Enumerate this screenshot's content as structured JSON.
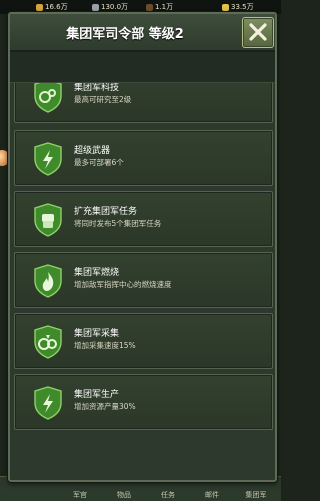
{
  "resources": [
    {
      "icon": "food-icon",
      "value": "16.6万",
      "color": "#d8a43a"
    },
    {
      "icon": "ore-icon",
      "value": "130.0万",
      "color": "#9aa0a8"
    },
    {
      "icon": "oil-icon",
      "value": "1.1万",
      "color": "#6b4b2a"
    },
    {
      "icon": "cash-icon",
      "value": "33.5万",
      "color": "#e3c24a"
    }
  ],
  "modal": {
    "title": "集团军司令部 等级2",
    "close_icon": "close-x-icon"
  },
  "items": [
    {
      "title": "集团军科技",
      "desc": "最高可研究至2级",
      "icon": "research-icon"
    },
    {
      "title": "超级武器",
      "desc": "最多可部署6个",
      "icon": "lightning-icon"
    },
    {
      "title": "扩充集团军任务",
      "desc": "将同时发布5个集团军任务",
      "icon": "fist-icon"
    },
    {
      "title": "集团军燃烧",
      "desc": "增加敌军指挥中心的燃烧速度",
      "icon": "fire-icon"
    },
    {
      "title": "集团军采集",
      "desc": "增加采集速度15%",
      "icon": "gather-icon"
    },
    {
      "title": "集团军生产",
      "desc": "增加资源产量30%",
      "icon": "lightning-icon"
    }
  ],
  "bottom_nav": [
    "军官",
    "物品",
    "任务",
    "邮件",
    "集团军"
  ],
  "colors": {
    "accent": "#5aa033",
    "panel": "#2c392c",
    "shield": "#3f8a2a"
  }
}
